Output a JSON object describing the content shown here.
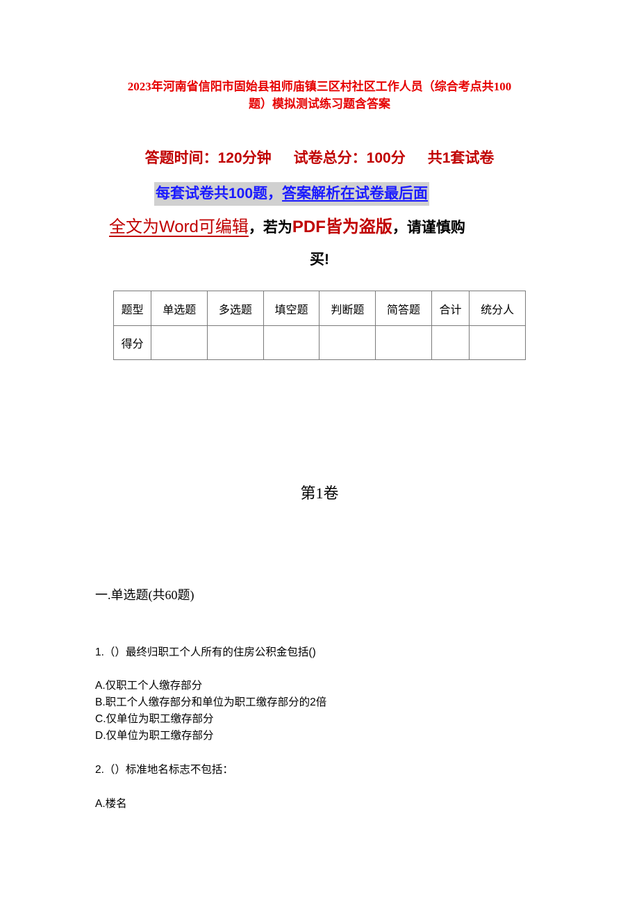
{
  "document": {
    "title_line1": "2023年河南省信阳市固始县祖师庙镇三区村社区工作人员（综合考点共100",
    "title_line2": "题）模拟测试练习题含答案",
    "meta": {
      "time": "答题时间：120分钟",
      "total": "试卷总分：100分",
      "sets": "共1套试卷"
    },
    "notice_blue_part1": "每套试卷共100题，",
    "notice_blue_part2": "答案解析在试卷最后面",
    "warning": {
      "part1": "全文为Word可编辑",
      "comma1": "，若为",
      "part2": "PDF皆为盗版",
      "part3": "，请谨慎购",
      "line2": "买!"
    },
    "score_table": {
      "headers": [
        "题型",
        "单选题",
        "多选题",
        "填空题",
        "判断题",
        "简答题",
        "合计",
        "统分人"
      ],
      "row_label": "得分",
      "row_values": [
        "",
        "",
        "",
        "",
        "",
        "",
        ""
      ]
    },
    "volume": "第1卷",
    "section": "一.单选题(共60题)",
    "questions": [
      {
        "stem": "1.（）最终归职工个人所有的住房公积金包括()",
        "options": [
          "A.仅职工个人缴存部分",
          "B.职工个人缴存部分和单位为职工缴存部分的2倍",
          "C.仅单位为职工缴存部分",
          "D.仅单位为职工缴存部分"
        ]
      },
      {
        "stem": "2.（）标准地名标志不包括：",
        "options": [
          "A.楼名"
        ]
      }
    ]
  }
}
